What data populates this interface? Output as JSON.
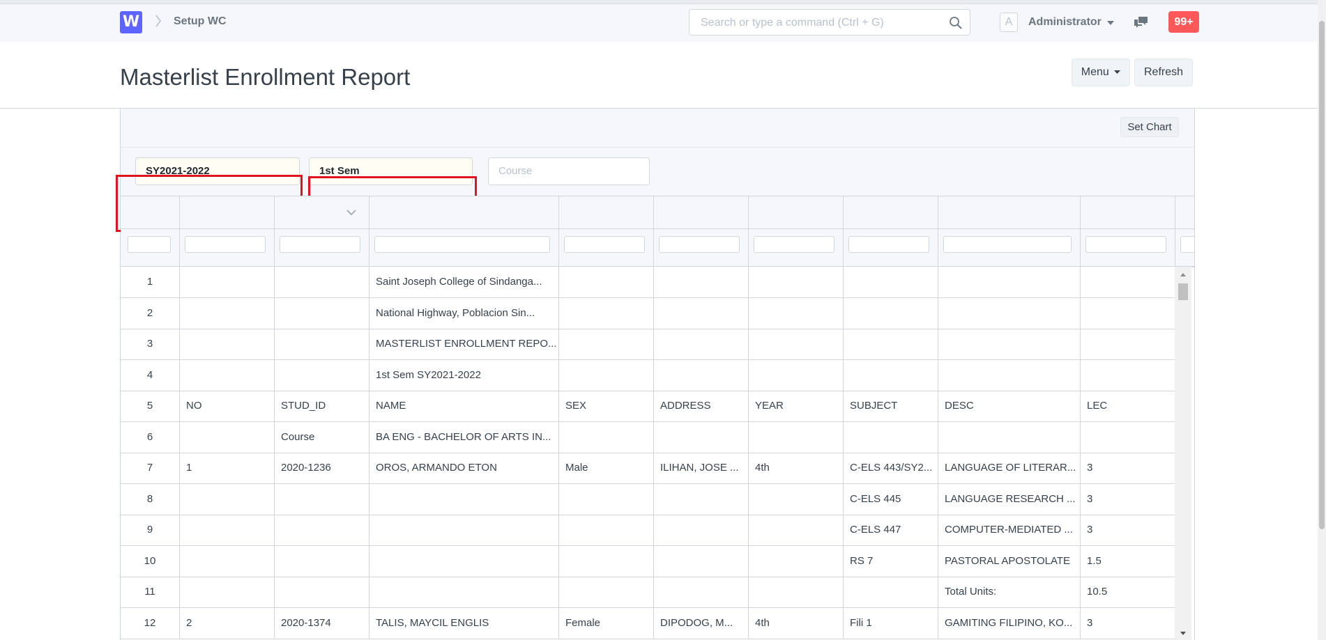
{
  "navbar": {
    "logo_letter": "W",
    "breadcrumb": "Setup WC",
    "search_placeholder": "Search or type a command (Ctrl + G)",
    "avatar_letter": "A",
    "user_name": "Administrator",
    "notification_count": "99+"
  },
  "page": {
    "title": "Masterlist Enrollment Report",
    "menu_label": "Menu",
    "refresh_label": "Refresh",
    "set_chart_label": "Set Chart"
  },
  "filters": {
    "school_year": "SY2021-2022",
    "semester": "1st Sem",
    "course_placeholder": "Course"
  },
  "colors": {
    "accent": "#5e64ff",
    "notification": "#ff5858",
    "highlight_box": "#e0141e"
  },
  "rows": [
    {
      "idx": "1",
      "c1": "",
      "c2": "",
      "c3": "Saint Joseph College of Sindanga...",
      "c4": "",
      "c5": "",
      "c6": "",
      "c7": "",
      "c8": "",
      "c9": ""
    },
    {
      "idx": "2",
      "c1": "",
      "c2": "",
      "c3": "National Highway, Poblacion Sin...",
      "c4": "",
      "c5": "",
      "c6": "",
      "c7": "",
      "c8": "",
      "c9": ""
    },
    {
      "idx": "3",
      "c1": "",
      "c2": "",
      "c3": "MASTERLIST ENROLLMENT REPO...",
      "c4": "",
      "c5": "",
      "c6": "",
      "c7": "",
      "c8": "",
      "c9": ""
    },
    {
      "idx": "4",
      "c1": "",
      "c2": "",
      "c3": "1st Sem SY2021-2022",
      "c4": "",
      "c5": "",
      "c6": "",
      "c7": "",
      "c8": "",
      "c9": ""
    },
    {
      "idx": "5",
      "c1": "NO",
      "c2": "STUD_ID",
      "c3": "NAME",
      "c4": "SEX",
      "c5": "ADDRESS",
      "c6": "YEAR",
      "c7": "SUBJECT",
      "c8": "DESC",
      "c9": "LEC"
    },
    {
      "idx": "6",
      "c1": "",
      "c2": "Course",
      "c3": "BA ENG - BACHELOR OF ARTS IN...",
      "c4": "",
      "c5": "",
      "c6": "",
      "c7": "",
      "c8": "",
      "c9": ""
    },
    {
      "idx": "7",
      "c1": "1",
      "c2": "2020-1236",
      "c3": "OROS, ARMANDO ETON",
      "c4": "Male",
      "c5": "ILIHAN, JOSE ...",
      "c6": "4th",
      "c7": "C-ELS 443/SY2...",
      "c8": "LANGUAGE OF LITERAR...",
      "c9": "3"
    },
    {
      "idx": "8",
      "c1": "",
      "c2": "",
      "c3": "",
      "c4": "",
      "c5": "",
      "c6": "",
      "c7": "C-ELS 445",
      "c8": "LANGUAGE RESEARCH ...",
      "c9": "3"
    },
    {
      "idx": "9",
      "c1": "",
      "c2": "",
      "c3": "",
      "c4": "",
      "c5": "",
      "c6": "",
      "c7": "C-ELS 447",
      "c8": "COMPUTER-MEDIATED ...",
      "c9": "3"
    },
    {
      "idx": "10",
      "c1": "",
      "c2": "",
      "c3": "",
      "c4": "",
      "c5": "",
      "c6": "",
      "c7": "RS 7",
      "c8": "PASTORAL APOSTOLATE",
      "c9": "1.5"
    },
    {
      "idx": "11",
      "c1": "",
      "c2": "",
      "c3": "",
      "c4": "",
      "c5": "",
      "c6": "",
      "c7": "",
      "c8": "Total Units:",
      "c9": "10.5"
    },
    {
      "idx": "12",
      "c1": "2",
      "c2": "2020-1374",
      "c3": "TALIS, MAYCIL ENGLIS",
      "c4": "Female",
      "c5": "DIPODOG, M...",
      "c6": "4th",
      "c7": "Fili 1",
      "c8": "GAMITING FILIPINO, KO...",
      "c9": "3"
    }
  ]
}
